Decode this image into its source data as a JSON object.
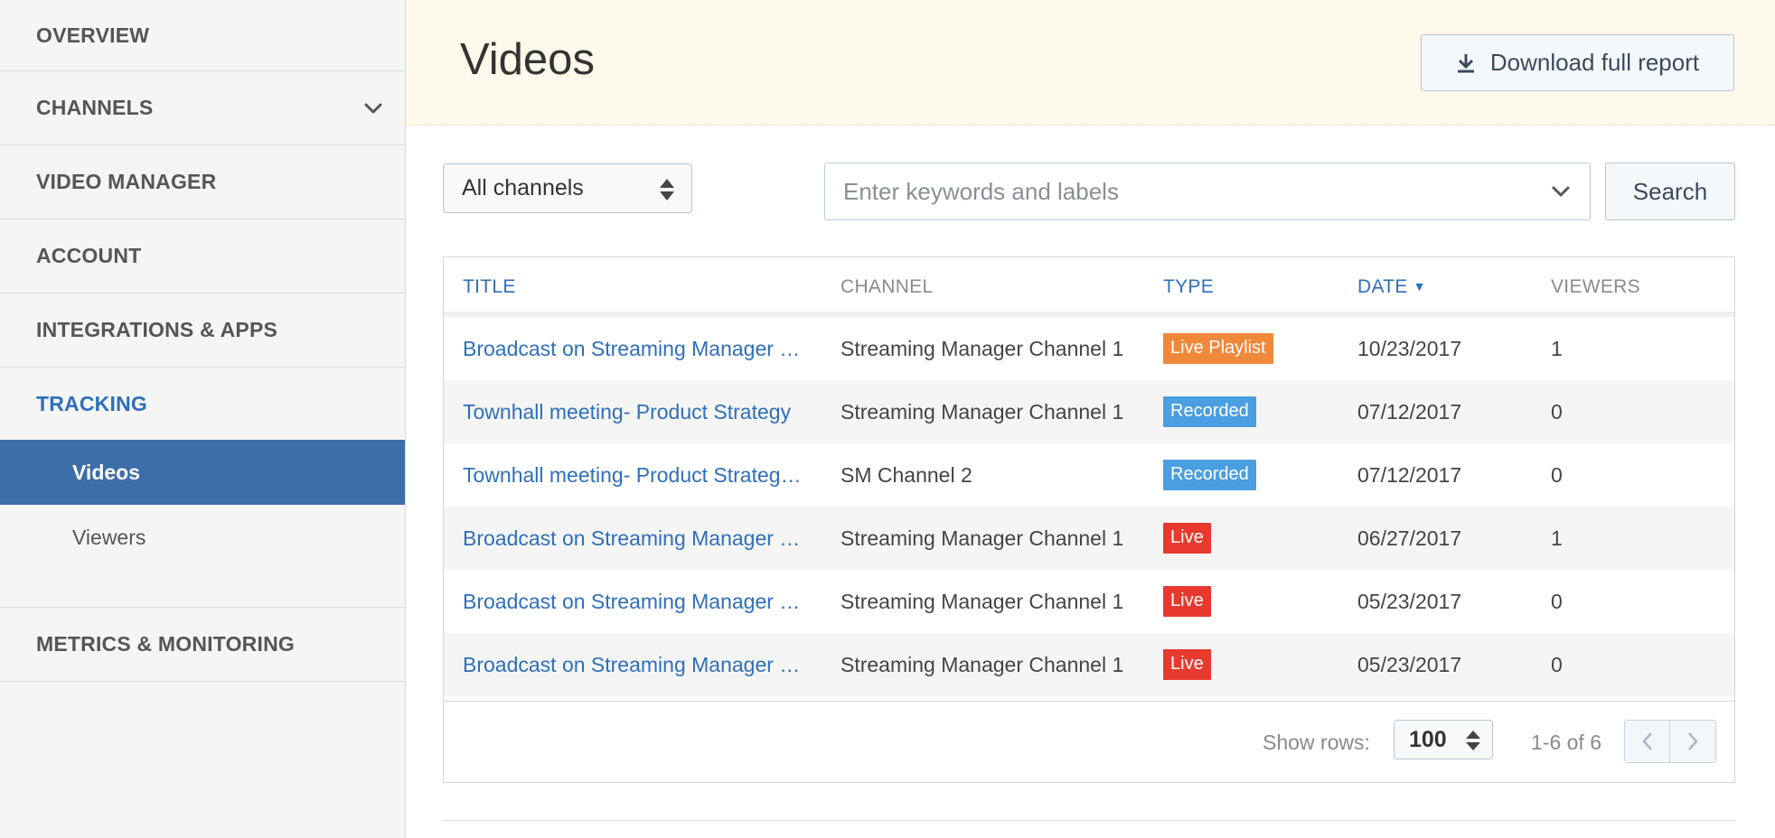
{
  "sidebar": {
    "items": [
      {
        "label": "OVERVIEW"
      },
      {
        "label": "CHANNELS"
      },
      {
        "label": "VIDEO MANAGER"
      },
      {
        "label": "ACCOUNT"
      },
      {
        "label": "INTEGRATIONS & APPS"
      },
      {
        "label": "TRACKING"
      },
      {
        "label": "METRICS & MONITORING"
      }
    ],
    "tracking_sub": [
      {
        "label": "Videos"
      },
      {
        "label": "Viewers"
      }
    ]
  },
  "header": {
    "title": "Videos",
    "download_label": "Download full report"
  },
  "filters": {
    "channel_select": "All channels",
    "search_placeholder": "Enter keywords and labels",
    "search_label": "Search"
  },
  "table": {
    "headers": {
      "title": "TITLE",
      "channel": "CHANNEL",
      "type": "TYPE",
      "date": "DATE",
      "viewers": "VIEWERS"
    },
    "rows": [
      {
        "title": "Broadcast on Streaming Manager …",
        "channel": "Streaming Manager Channel 1",
        "type": "Live Playlist",
        "date": "10/23/2017",
        "viewers": "1"
      },
      {
        "title": "Townhall meeting- Product Strategy",
        "channel": "Streaming Manager Channel 1",
        "type": "Recorded",
        "date": "07/12/2017",
        "viewers": "0"
      },
      {
        "title": "Townhall meeting- Product Strateg…",
        "channel": "SM Channel 2",
        "type": "Recorded",
        "date": "07/12/2017",
        "viewers": "0"
      },
      {
        "title": "Broadcast on Streaming Manager …",
        "channel": "Streaming Manager Channel 1",
        "type": "Live",
        "date": "06/27/2017",
        "viewers": "1"
      },
      {
        "title": "Broadcast on Streaming Manager …",
        "channel": "Streaming Manager Channel 1",
        "type": "Live",
        "date": "05/23/2017",
        "viewers": "0"
      },
      {
        "title": "Broadcast on Streaming Manager …",
        "channel": "Streaming Manager Channel 1",
        "type": "Live",
        "date": "05/23/2017",
        "viewers": "0"
      }
    ],
    "footer": {
      "show_rows_label": "Show rows:",
      "rows_value": "100",
      "range": "1-6 of 6"
    }
  },
  "colors": {
    "accent": "#2e6fba",
    "selected_nav": "#3e6ea8",
    "badge_live_playlist": "#f0883a",
    "badge_recorded": "#4a9ee2",
    "badge_live": "#e8392e",
    "header_bg": "#fef9ea"
  }
}
